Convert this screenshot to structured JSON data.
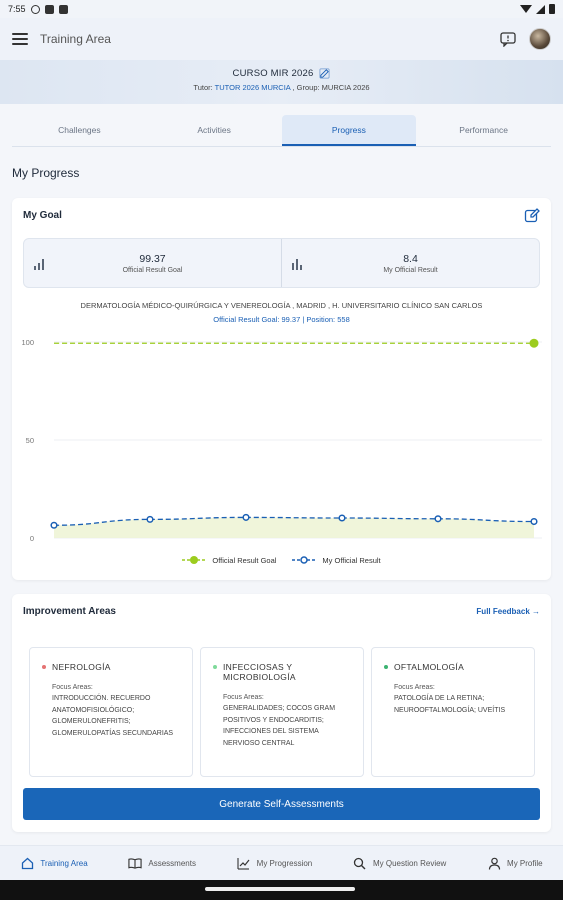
{
  "status_bar": {
    "time": "7:55"
  },
  "appbar": {
    "title": "Training Area"
  },
  "banner": {
    "course": "CURSO MIR 2026",
    "tutor_prefix": "Tutor: ",
    "tutor_name": "TUTOR 2026 MURCIA",
    "group_text": " , Group: MURCIA 2026"
  },
  "tabs": [
    {
      "label": "Challenges"
    },
    {
      "label": "Activities"
    },
    {
      "label": "Progress",
      "active": true
    },
    {
      "label": "Performance"
    }
  ],
  "section_title": "My Progress",
  "goal": {
    "title": "My Goal",
    "stats": [
      {
        "value": "99.37",
        "label": "Official Result Goal"
      },
      {
        "value": "8.4",
        "label": "My Official Result"
      }
    ],
    "caption": "DERMATOLOGÍA MÉDICO-QUIRÚRGICA Y VENEREOLOGÍA , MADRID , H. UNIVERSITARIO CLÍNICO SAN CARLOS",
    "caption_link": "Official Result Goal: 99.37 | Position: 558"
  },
  "chart_data": {
    "type": "line",
    "ylim": [
      0,
      100
    ],
    "yticks": [
      "100",
      "50",
      "0"
    ],
    "ytick_values": [
      100,
      50,
      0
    ],
    "grid": true,
    "legend_position": "bottom",
    "series": [
      {
        "name": "Official Result Goal",
        "color": "#9ccc1e",
        "style": "dashed",
        "values": [
          99.37,
          99.37,
          99.37,
          99.37,
          99.37,
          99.37
        ],
        "marker_indices": [
          5
        ]
      },
      {
        "name": "My Official Result",
        "color": "#1a5fb4",
        "style": "dashed",
        "values": [
          6.5,
          9.5,
          10.5,
          10.2,
          9.8,
          8.4
        ],
        "marker_indices": [
          0,
          1,
          2,
          3,
          4,
          5
        ]
      }
    ]
  },
  "improvement": {
    "title": "Improvement Areas",
    "full_feedback": "Full Feedback →",
    "areas": [
      {
        "title": "NEFROLOGÍA",
        "dot_color": "#e57373",
        "focus_label": "Focus Areas:",
        "focus_text": "INTRODUCCIÓN. RECUERDO ANATOMOFISIOLÓGICO; GLOMERULONEFRITIS; GLOMERULOPATÍAS SECUNDARIAS"
      },
      {
        "title": "INFECCIOSAS Y MICROBIOLOGÍA",
        "dot_color": "#7ed99a",
        "focus_label": "Focus Areas:",
        "focus_text": "GENERALIDADES; COCOS GRAM POSITIVOS Y ENDOCARDITIS; INFECCIONES DEL SISTEMA NERVIOSO CENTRAL"
      },
      {
        "title": "OFTALMOLOGÍA",
        "dot_color": "#3cb371",
        "focus_label": "Focus Areas:",
        "focus_text": "PATOLOGÍA DE LA RETINA; NEUROOFTALMOLOGÍA; UVEÍTIS"
      }
    ],
    "button": "Generate Self-Assessments"
  },
  "bottom_nav": [
    {
      "label": "Training Area",
      "icon": "home-icon",
      "active": true
    },
    {
      "label": "Assessments",
      "icon": "book-icon"
    },
    {
      "label": "My Progression",
      "icon": "trend-icon"
    },
    {
      "label": "My Question Review",
      "icon": "search-icon"
    },
    {
      "label": "My Profile",
      "icon": "person-icon"
    }
  ]
}
